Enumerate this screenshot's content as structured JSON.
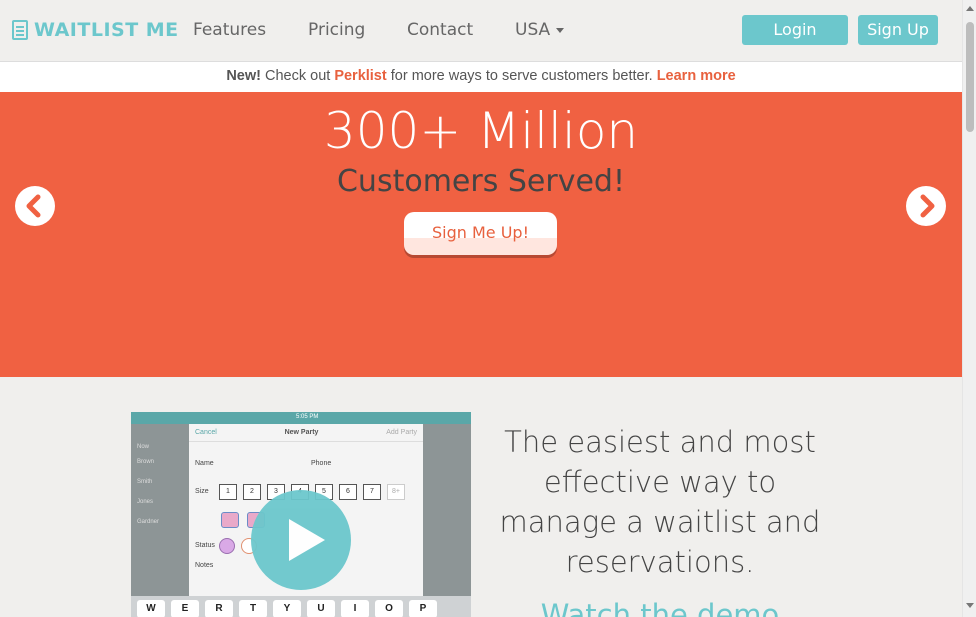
{
  "brand": {
    "name": "WAITLIST ME",
    "icon": "clipboard-icon",
    "color": "#6cc7cc"
  },
  "nav": {
    "links": [
      "Features",
      "Pricing",
      "Contact"
    ],
    "country": "USA",
    "login": "Login",
    "signup": "Sign Up"
  },
  "announcement": {
    "new_label": "New!",
    "text_before": " Check out ",
    "product": "Perklist",
    "text_after": " for more ways to serve customers better. ",
    "learn_more": "Learn more"
  },
  "hero": {
    "headline": "300+ Million",
    "subheadline": "Customers Served!",
    "cta": "Sign Me Up!",
    "color": "#f06142",
    "prev_icon": "chevron-left-icon",
    "next_icon": "chevron-right-icon"
  },
  "video": {
    "status_time": "5:05 PM",
    "cancel": "Cancel",
    "title": "New Party",
    "add_party": "Add Party",
    "name_label": "Name",
    "phone_label": "Phone",
    "size_label": "Size",
    "sizes": [
      "1",
      "2",
      "3",
      "4",
      "5",
      "6",
      "7",
      "8+"
    ],
    "status_label": "Status",
    "notes_label": "Notes",
    "list_header": "Now",
    "list_names": [
      "Brown",
      "Smith",
      "Jones",
      "Gardner"
    ],
    "keys": [
      "W",
      "E",
      "R",
      "T",
      "Y",
      "U",
      "I",
      "O",
      "P"
    ]
  },
  "feature": {
    "tagline": "The easiest and most effective way to manage a waitlist and reservations.",
    "watch_demo": "Watch the demo"
  }
}
